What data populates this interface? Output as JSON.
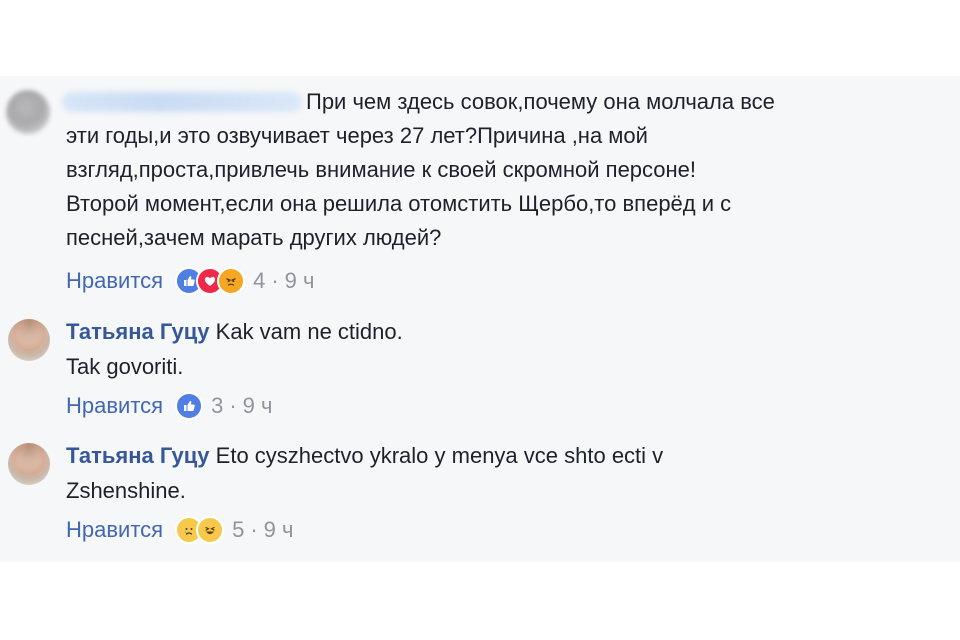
{
  "comments": [
    {
      "author": "",
      "text": "При чем здесь совок,почему она молчала все\nэти годы,и это озвучивает через 27 лет?Причина ,на мой\nвзгляд,проста,привлечь внимание к своей скромной персоне!\nВторой момент,если она решила отомстить Щербо,то вперёд и с\nпесней,зачем марать других людей?",
      "like_label": "Нравится",
      "reaction_icons": [
        "like-icon",
        "love-icon",
        "angry-icon"
      ],
      "reaction_count": "4",
      "time": "9 ч"
    },
    {
      "author": "Татьяна Гуцу",
      "text_line1": "Kak vam ne ctidno.",
      "text_line2": "Tak govoriti.",
      "like_label": "Нравится",
      "reaction_icons": [
        "like-icon"
      ],
      "reaction_count": "3",
      "time": "9 ч"
    },
    {
      "author": "Татьяна Гуцу",
      "text_line1": "Eto cyszhectvo ykralo y menya vce shto ecti v",
      "text_line2": "Zshenshine.",
      "like_label": "Нравится",
      "reaction_icons": [
        "sad-icon",
        "haha-icon"
      ],
      "reaction_count": "5",
      "time": "9 ч"
    }
  ],
  "separator": "·",
  "colors": {
    "link": "#4267b2",
    "author": "#365899",
    "text": "#1d2129",
    "meta": "#90949c",
    "background": "#f6f7f9"
  }
}
